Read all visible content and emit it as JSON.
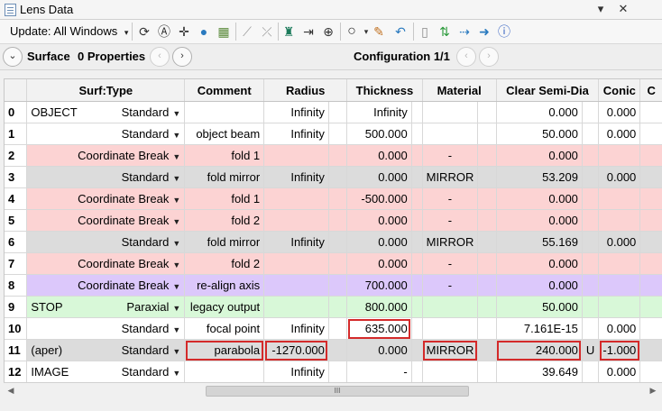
{
  "window": {
    "title": "Lens Data",
    "pin": "▾",
    "close": "✕"
  },
  "toolbar": {
    "update_label": "Update: All Windows",
    "icons": [
      "refresh-icon",
      "auto-refresh-icon",
      "crosshair-icon",
      "globe-icon",
      "map-icon",
      "slice-icon",
      "slice-x-icon",
      "figure-icon",
      "arrow-lens-icon",
      "lens-icon",
      "circle-icon",
      "pen-icon",
      "curve-arrow-icon",
      "page-icon",
      "swap-icon",
      "arrows-icon",
      "right-arrow-icon",
      "help-icon"
    ]
  },
  "subbar": {
    "surface_label": "Surface",
    "properties": "0 Properties",
    "configuration": "Configuration 1/1"
  },
  "columns": [
    "Surf:Type",
    "Comment",
    "Radius",
    "Thickness",
    "Material",
    "Clear Semi-Dia",
    "Conic",
    "C"
  ],
  "rows": [
    {
      "num": "0",
      "name": "OBJECT",
      "type": "Standard",
      "comment": "",
      "radius": "Infinity",
      "thickness": "Infinity",
      "material": "",
      "semidia": "0.000",
      "flag": "",
      "conic": "0.000",
      "style": "white"
    },
    {
      "num": "1",
      "name": "",
      "type": "Standard",
      "comment": "object beam",
      "radius": "Infinity",
      "thickness": "500.000",
      "material": "",
      "semidia": "50.000",
      "flag": "",
      "conic": "0.000",
      "style": "white"
    },
    {
      "num": "2",
      "name": "",
      "type": "Coordinate Break",
      "comment": "fold 1",
      "radius": "",
      "thickness": "0.000",
      "material": "-",
      "semidia": "0.000",
      "flag": "",
      "conic": "",
      "style": "pink"
    },
    {
      "num": "3",
      "name": "",
      "type": "Standard",
      "comment": "fold mirror",
      "radius": "Infinity",
      "thickness": "0.000",
      "material": "MIRROR",
      "semidia": "53.209",
      "flag": "",
      "conic": "0.000",
      "style": "gray"
    },
    {
      "num": "4",
      "name": "",
      "type": "Coordinate Break",
      "comment": "fold 1",
      "radius": "",
      "thickness": "-500.000",
      "material": "-",
      "semidia": "0.000",
      "flag": "",
      "conic": "",
      "style": "pink"
    },
    {
      "num": "5",
      "name": "",
      "type": "Coordinate Break",
      "comment": "fold 2",
      "radius": "",
      "thickness": "0.000",
      "material": "-",
      "semidia": "0.000",
      "flag": "",
      "conic": "",
      "style": "pink"
    },
    {
      "num": "6",
      "name": "",
      "type": "Standard",
      "comment": "fold mirror",
      "radius": "Infinity",
      "thickness": "0.000",
      "material": "MIRROR",
      "semidia": "55.169",
      "flag": "",
      "conic": "0.000",
      "style": "gray"
    },
    {
      "num": "7",
      "name": "",
      "type": "Coordinate Break",
      "comment": "fold 2",
      "radius": "",
      "thickness": "0.000",
      "material": "-",
      "semidia": "0.000",
      "flag": "",
      "conic": "",
      "style": "pink"
    },
    {
      "num": "8",
      "name": "",
      "type": "Coordinate Break",
      "comment": "re-align axis",
      "radius": "",
      "thickness": "700.000",
      "material": "-",
      "semidia": "0.000",
      "flag": "",
      "conic": "",
      "style": "purple"
    },
    {
      "num": "9",
      "name": "STOP",
      "type": "Paraxial",
      "comment": "legacy output",
      "radius": "",
      "thickness": "800.000",
      "material": "",
      "semidia": "50.000",
      "flag": "",
      "conic": "",
      "style": "green"
    },
    {
      "num": "10",
      "name": "",
      "type": "Standard",
      "comment": "focal point",
      "radius": "Infinity",
      "thickness": "635.000",
      "material": "",
      "semidia": "7.161E-15",
      "flag": "",
      "conic": "0.000",
      "style": "white"
    },
    {
      "num": "11",
      "name": "(aper)",
      "type": "Standard",
      "comment": "parabola",
      "radius": "-1270.000",
      "thickness": "0.000",
      "material": "MIRROR",
      "semidia": "240.000",
      "flag": "U",
      "conic": "-1.000",
      "style": "gray"
    },
    {
      "num": "12",
      "name": "IMAGE",
      "type": "Standard",
      "comment": "",
      "radius": "Infinity",
      "thickness": "-",
      "material": "",
      "semidia": "39.649",
      "flag": "",
      "conic": "0.000",
      "style": "white"
    }
  ],
  "scrollbar": {
    "thumb_grip": "III"
  },
  "colors": {
    "pink": "#fcd3d3",
    "gray": "#dcdcdc",
    "purple": "#dcc8fb",
    "green": "#d8f8d8",
    "highlight": "#d42a2a"
  }
}
